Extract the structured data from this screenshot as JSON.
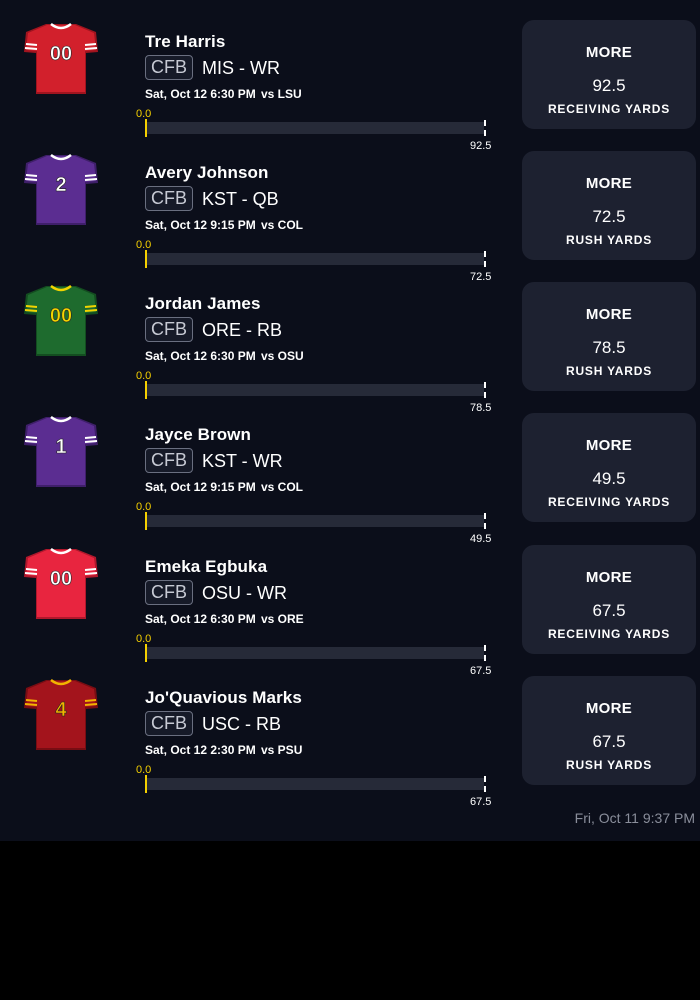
{
  "picks": [
    {
      "name": "Tre Harris",
      "league": "CFB",
      "team_pos": "MIS - WR",
      "time": "Sat, Oct 12 6:30 PM",
      "opponent": "vs LSU",
      "bar_start": "0.0",
      "bar_end": "92.5",
      "progress": 0,
      "direction": "MORE",
      "line": "92.5",
      "stat": "RECEIVING YARDS",
      "jersey": {
        "number": "00",
        "color": "#d2202c",
        "shade": "#a0141f",
        "trim": "#ffffff",
        "number_color": "#ffffff"
      }
    },
    {
      "name": "Avery Johnson",
      "league": "CFB",
      "team_pos": "KST - QB",
      "time": "Sat, Oct 12 9:15 PM",
      "opponent": "vs COL",
      "bar_start": "0.0",
      "bar_end": "72.5",
      "progress": 0,
      "direction": "MORE",
      "line": "72.5",
      "stat": "RUSH YARDS",
      "jersey": {
        "number": "2",
        "color": "#5b2d91",
        "shade": "#3f1f6a",
        "trim": "#ffffff",
        "number_color": "#ffffff"
      }
    },
    {
      "name": "Jordan James",
      "league": "CFB",
      "team_pos": "ORE - RB",
      "time": "Sat, Oct 12 6:30 PM",
      "opponent": "vs OSU",
      "bar_start": "0.0",
      "bar_end": "78.5",
      "progress": 0,
      "direction": "MORE",
      "line": "78.5",
      "stat": "RUSH YARDS",
      "jersey": {
        "number": "00",
        "color": "#1e6b2e",
        "shade": "#134d20",
        "trim": "#f2d400",
        "number_color": "#f2d400"
      }
    },
    {
      "name": "Jayce Brown",
      "league": "CFB",
      "team_pos": "KST - WR",
      "time": "Sat, Oct 12 9:15 PM",
      "opponent": "vs COL",
      "bar_start": "0.0",
      "bar_end": "49.5",
      "progress": 0,
      "direction": "MORE",
      "line": "49.5",
      "stat": "RECEIVING YARDS",
      "jersey": {
        "number": "1",
        "color": "#5b2d91",
        "shade": "#3f1f6a",
        "trim": "#ffffff",
        "number_color": "#ffffff"
      }
    },
    {
      "name": "Emeka Egbuka",
      "league": "CFB",
      "team_pos": "OSU - WR",
      "time": "Sat, Oct 12 6:30 PM",
      "opponent": "vs ORE",
      "bar_start": "0.0",
      "bar_end": "67.5",
      "progress": 0,
      "direction": "MORE",
      "line": "67.5",
      "stat": "RECEIVING YARDS",
      "jersey": {
        "number": "00",
        "color": "#e8253f",
        "shade": "#b0182c",
        "trim": "#ffffff",
        "number_color": "#ffffff"
      }
    },
    {
      "name": "Jo'Quavious Marks",
      "league": "CFB",
      "team_pos": "USC - RB",
      "time": "Sat, Oct 12 2:30 PM",
      "opponent": "vs PSU",
      "bar_start": "0.0",
      "bar_end": "67.5",
      "progress": 0,
      "direction": "MORE",
      "line": "67.5",
      "stat": "RUSH YARDS",
      "jersey": {
        "number": "4",
        "color": "#a3141c",
        "shade": "#780d13",
        "trim": "#f2b400",
        "number_color": "#f2b400"
      }
    }
  ],
  "footer": {
    "timestamp": "Fri, Oct 11 9:37 PM"
  }
}
